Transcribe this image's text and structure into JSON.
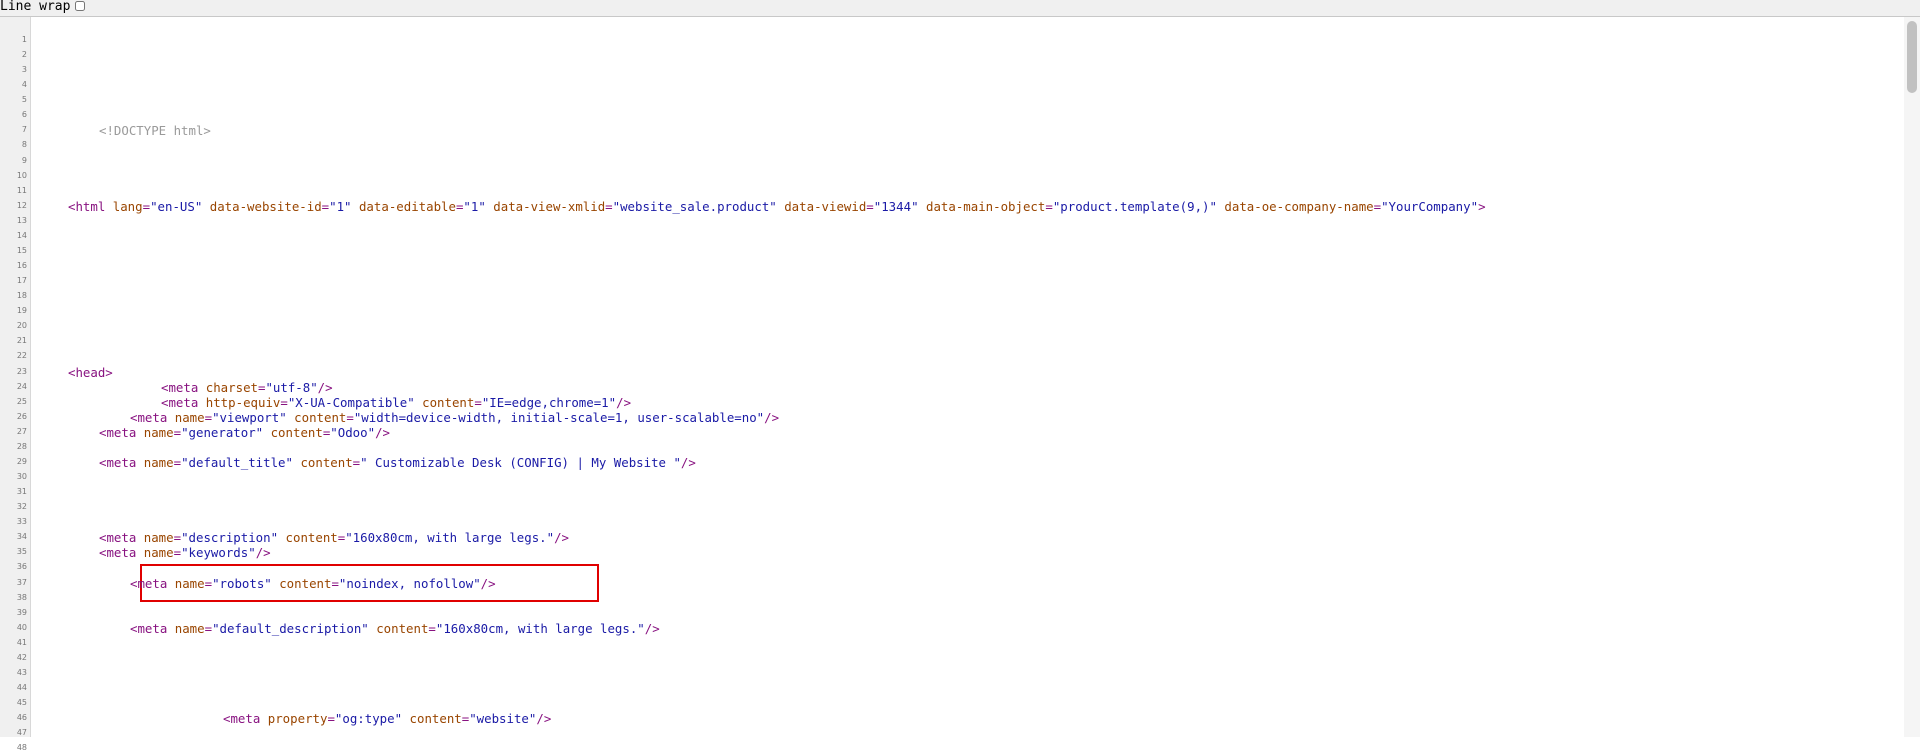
{
  "toolbar": {
    "line_wrap_label": "Line wrap",
    "line_wrap_checked": false
  },
  "line_numbers": [
    "1",
    "2",
    "3",
    "4",
    "5",
    "6",
    "7",
    "8",
    "9",
    "10",
    "11",
    "12",
    "13",
    "14",
    "15",
    "16",
    "17",
    "18",
    "19",
    "20",
    "21",
    "22",
    "23",
    "24",
    "25",
    "26",
    "27",
    "28",
    "29",
    "30",
    "31",
    "32",
    "33",
    "34",
    "35",
    "36",
    "37",
    "38",
    "39",
    "40",
    "41",
    "42",
    "43",
    "44",
    "45",
    "46",
    "47",
    "48"
  ],
  "code_lines": [
    {
      "line": 7,
      "tokens": [
        {
          "t": "doctype",
          "s": "<!DOCTYPE html>"
        }
      ]
    },
    {
      "line": 12,
      "tokens": [
        {
          "t": "tag",
          "s": "<html "
        },
        {
          "t": "attr",
          "s": "lang"
        },
        {
          "t": "tag",
          "s": "="
        },
        {
          "t": "val",
          "s": "\"en-US\""
        },
        {
          "t": "attr",
          "s": " data-website-id"
        },
        {
          "t": "tag",
          "s": "="
        },
        {
          "t": "val",
          "s": "\"1\""
        },
        {
          "t": "attr",
          "s": " data-editable"
        },
        {
          "t": "tag",
          "s": "="
        },
        {
          "t": "val",
          "s": "\"1\""
        },
        {
          "t": "attr",
          "s": " data-view-xmlid"
        },
        {
          "t": "tag",
          "s": "="
        },
        {
          "t": "val",
          "s": "\"website_sale.product\""
        },
        {
          "t": "attr",
          "s": " data-viewid"
        },
        {
          "t": "tag",
          "s": "="
        },
        {
          "t": "val",
          "s": "\"1344\""
        },
        {
          "t": "attr",
          "s": " data-main-object"
        },
        {
          "t": "tag",
          "s": "="
        },
        {
          "t": "val",
          "s": "\"product.template(9,)\""
        },
        {
          "t": "attr",
          "s": " data-oe-company-name"
        },
        {
          "t": "tag",
          "s": "="
        },
        {
          "t": "val",
          "s": "\"YourCompany\""
        },
        {
          "t": "tag",
          "s": ">"
        }
      ]
    },
    {
      "line": 23,
      "tokens": [
        {
          "t": "tag",
          "s": "<head>"
        }
      ]
    },
    {
      "line": 24,
      "tokens": [
        {
          "t": "tag",
          "s": "<meta "
        },
        {
          "t": "attr",
          "s": "charset"
        },
        {
          "t": "tag",
          "s": "="
        },
        {
          "t": "val",
          "s": "\"utf-8\""
        },
        {
          "t": "tag",
          "s": "/>"
        }
      ]
    },
    {
      "line": 25,
      "tokens": [
        {
          "t": "tag",
          "s": "<meta "
        },
        {
          "t": "attr",
          "s": "http-equiv"
        },
        {
          "t": "tag",
          "s": "="
        },
        {
          "t": "val",
          "s": "\"X-UA-Compatible\""
        },
        {
          "t": "attr",
          "s": " content"
        },
        {
          "t": "tag",
          "s": "="
        },
        {
          "t": "val",
          "s": "\"IE=edge,chrome=1\""
        },
        {
          "t": "tag",
          "s": "/>"
        }
      ]
    },
    {
      "line": 26,
      "tokens": [
        {
          "t": "tag",
          "s": "<meta "
        },
        {
          "t": "attr",
          "s": "name"
        },
        {
          "t": "tag",
          "s": "="
        },
        {
          "t": "val",
          "s": "\"viewport\""
        },
        {
          "t": "attr",
          "s": " content"
        },
        {
          "t": "tag",
          "s": "="
        },
        {
          "t": "val",
          "s": "\"width=device-width, initial-scale=1, user-scalable=no\""
        },
        {
          "t": "tag",
          "s": "/>"
        }
      ]
    },
    {
      "line": 27,
      "tokens": [
        {
          "t": "tag",
          "s": "<meta "
        },
        {
          "t": "attr",
          "s": "name"
        },
        {
          "t": "tag",
          "s": "="
        },
        {
          "t": "val",
          "s": "\"generator\""
        },
        {
          "t": "attr",
          "s": " content"
        },
        {
          "t": "tag",
          "s": "="
        },
        {
          "t": "val",
          "s": "\"Odoo\""
        },
        {
          "t": "tag",
          "s": "/>"
        }
      ]
    },
    {
      "line": 29,
      "tokens": [
        {
          "t": "tag",
          "s": "<meta "
        },
        {
          "t": "attr",
          "s": "name"
        },
        {
          "t": "tag",
          "s": "="
        },
        {
          "t": "val",
          "s": "\"default_title\""
        },
        {
          "t": "attr",
          "s": " content"
        },
        {
          "t": "tag",
          "s": "="
        },
        {
          "t": "val",
          "s": "\" Customizable Desk (CONFIG) | My Website \""
        },
        {
          "t": "tag",
          "s": "/>"
        }
      ]
    },
    {
      "line": 34,
      "tokens": [
        {
          "t": "tag",
          "s": "<meta "
        },
        {
          "t": "attr",
          "s": "name"
        },
        {
          "t": "tag",
          "s": "="
        },
        {
          "t": "val",
          "s": "\"description\""
        },
        {
          "t": "attr",
          "s": " content"
        },
        {
          "t": "tag",
          "s": "="
        },
        {
          "t": "val",
          "s": "\"160x80cm, with large legs.\""
        },
        {
          "t": "tag",
          "s": "/>"
        }
      ]
    },
    {
      "line": 35,
      "tokens": [
        {
          "t": "tag",
          "s": "<meta "
        },
        {
          "t": "attr",
          "s": "name"
        },
        {
          "t": "tag",
          "s": "="
        },
        {
          "t": "val",
          "s": "\"keywords\""
        },
        {
          "t": "tag",
          "s": "/>"
        }
      ]
    },
    {
      "line": 37,
      "tokens": [
        {
          "t": "tag",
          "s": "<meta "
        },
        {
          "t": "attr",
          "s": "name"
        },
        {
          "t": "tag",
          "s": "="
        },
        {
          "t": "val",
          "s": "\"robots\""
        },
        {
          "t": "attr",
          "s": " content"
        },
        {
          "t": "tag",
          "s": "="
        },
        {
          "t": "val",
          "s": "\"noindex, nofollow\""
        },
        {
          "t": "tag",
          "s": "/>"
        }
      ]
    },
    {
      "line": 40,
      "tokens": [
        {
          "t": "tag",
          "s": "<meta "
        },
        {
          "t": "attr",
          "s": "name"
        },
        {
          "t": "tag",
          "s": "="
        },
        {
          "t": "val",
          "s": "\"default_description\""
        },
        {
          "t": "attr",
          "s": " content"
        },
        {
          "t": "tag",
          "s": "="
        },
        {
          "t": "val",
          "s": "\"160x80cm, with large legs.\""
        },
        {
          "t": "tag",
          "s": "/>"
        }
      ]
    },
    {
      "line": 46,
      "tokens": [
        {
          "t": "tag",
          "s": "<meta "
        },
        {
          "t": "attr",
          "s": "property"
        },
        {
          "t": "tag",
          "s": "="
        },
        {
          "t": "val",
          "s": "\"og:type\""
        },
        {
          "t": "attr",
          "s": " content"
        },
        {
          "t": "tag",
          "s": "="
        },
        {
          "t": "val",
          "s": "\"website\""
        },
        {
          "t": "tag",
          "s": "/>"
        }
      ]
    }
  ],
  "highlight": {
    "line": 37,
    "color": "#e00000"
  },
  "colors": {
    "tag": "#881280",
    "attr": "#994500",
    "value": "#1a1aa6",
    "doctype": "#9a9a9a"
  }
}
